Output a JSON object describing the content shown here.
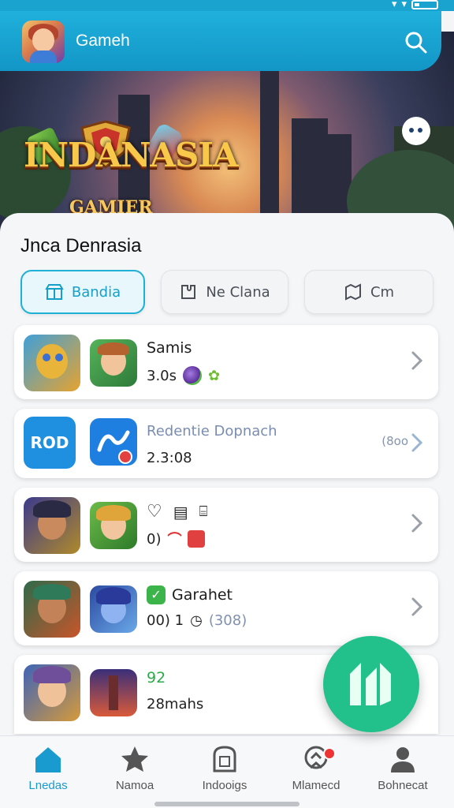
{
  "status_bar": {
    "icons": [
      "signal-icon",
      "wifi-icon",
      "battery-icon"
    ]
  },
  "header": {
    "title": "Gameh",
    "logo": "game-avatar-logo",
    "search_icon": "search-icon"
  },
  "hero": {
    "title": "INDANASIA",
    "subtitle": "GAMIER",
    "chat_icon": "chat-bubble-icon"
  },
  "section": {
    "title": "Jnca Denrasia"
  },
  "filters": [
    {
      "label": "Bandia",
      "icon": "store-icon",
      "active": true
    },
    {
      "label": "Ne Clana",
      "icon": "puzzle-icon",
      "active": false
    },
    {
      "label": "Cm",
      "icon": "map-icon",
      "active": false
    }
  ],
  "cards": [
    {
      "name": "Samis",
      "meta_text": "3.0s",
      "extra": ""
    },
    {
      "name": "Redentie Dopnach",
      "meta_text": "2.3:08",
      "extra": "(8oo"
    },
    {
      "name": "",
      "meta_text": "0)",
      "extra": ""
    },
    {
      "name": "Garahet",
      "meta_text": "00)  1",
      "extra": "(308)"
    },
    {
      "name": "92",
      "meta_text": "28mahs",
      "extra": ""
    }
  ],
  "card2_tile": "RОD",
  "nav": [
    {
      "label": "Lnedas",
      "icon": "home-icon",
      "active": true
    },
    {
      "label": "Namoa",
      "icon": "star-icon",
      "active": false
    },
    {
      "label": "Indooigs",
      "icon": "inbox-icon",
      "active": false
    },
    {
      "label": "Mlamecd",
      "icon": "map-pin-icon",
      "active": false
    },
    {
      "label": "Bohnecat",
      "icon": "profile-icon",
      "active": false
    }
  ],
  "colors": {
    "accent": "#1aa3cf",
    "fab": "#22c08a",
    "active_nav": "#1a9bd0"
  }
}
